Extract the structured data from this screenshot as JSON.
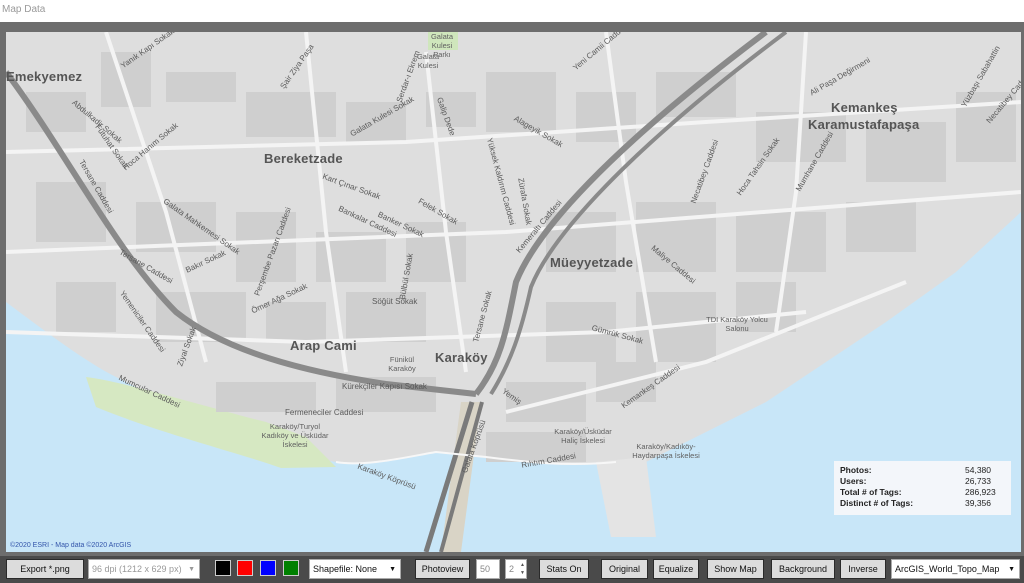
{
  "window": {
    "title": "Map Data"
  },
  "map": {
    "copyright": "©2020 ESRI - Map data ©2020 ArcGIS",
    "neighborhoods": [
      "Emekyemez",
      "Bereketzade",
      "Kemankeş",
      "Karamustafapaşa",
      "Müeyyetzade",
      "Arap Cami",
      "Karaköy"
    ],
    "streets": [
      "Yanık Kapı Sokak",
      "Şair Ziya Paşa",
      "Galata Kulesi Sokak",
      "Serdar-ı Ekrem",
      "Galip Dede",
      "Alageyik Sokak",
      "Yüksek Kaldırım Caddesi",
      "Zürafa Sokak",
      "Kemeraltı Caddesi",
      "Kart Çınar Sokak",
      "Felek Sokak",
      "Banker Sokak",
      "Bankalar Caddesi",
      "Galata Mahkemesi Sokak",
      "Tersane Caddesi",
      "Tersane Caddesi",
      "Perşembe Pazarı Caddesi",
      "Bakır Sokak",
      "Ömer Ağa Sokak",
      "Söğüt Sokak",
      "Bülbül Sokak",
      "Yemeniciler Caddesi",
      "Ziyal Sokak",
      "Mumcular Caddesi",
      "Fermeneciler Caddesi",
      "Kürekçiler Kapısı Sokak",
      "Necatibey Caddesi",
      "Hoca Tahsin Sokak",
      "Mumhane Caddesi",
      "Maliye Caddesi",
      "Gümrük Sokak",
      "Kemankeş Caddesi",
      "Rıhtım Caddesi",
      "Galata Köprüsü",
      "Ali Paşa Değirmeni",
      "Yüzbaşı Sabahattin",
      "Tersane Sokak",
      "Yeni Camii Caddesi",
      "Karaköy Köprüsü",
      "Yemiş",
      "Hoca Hanım Sokak",
      "Fütuhat Sokak",
      "Abdulkadir Sokak",
      "Necatibey Caddesi"
    ],
    "places": [
      "Galata Kulesi Parkı",
      "Galata Kulesi",
      "Fünikül Karaköy",
      "TDI Karaköy Yolcu Salonu",
      "Karaköy/Turyol Kadıköy ve Üsküdar İskelesi",
      "Karaköy/Üsküdar Haliç İskelesi",
      "Karaköy/Kadıköy-Haydarpaşa İskelesi"
    ]
  },
  "stats": {
    "rows": [
      {
        "label": "Photos:",
        "value": "54,380"
      },
      {
        "label": "Users:",
        "value": "26,733"
      },
      {
        "label": "Total # of Tags:",
        "value": "286,923"
      },
      {
        "label": "Distinct # of Tags:",
        "value": "39,356"
      }
    ]
  },
  "toolbar": {
    "export_label": "Export *.png",
    "dpi_value": "96 dpi (1212 x 629 px)",
    "colors": [
      "#000000",
      "#ff0000",
      "#0000ff",
      "#008000"
    ],
    "shapefile_value": "Shapefile: None",
    "photoview_label": "Photoview",
    "photoview_value": "50",
    "spin_value": "2",
    "stats_label": "Stats On",
    "original_label": "Original",
    "equalize_label": "Equalize",
    "showmap_label": "Show Map",
    "background_label": "Background",
    "inverse_label": "Inverse",
    "basemap_value": "ArcGIS_World_Topo_Map"
  }
}
